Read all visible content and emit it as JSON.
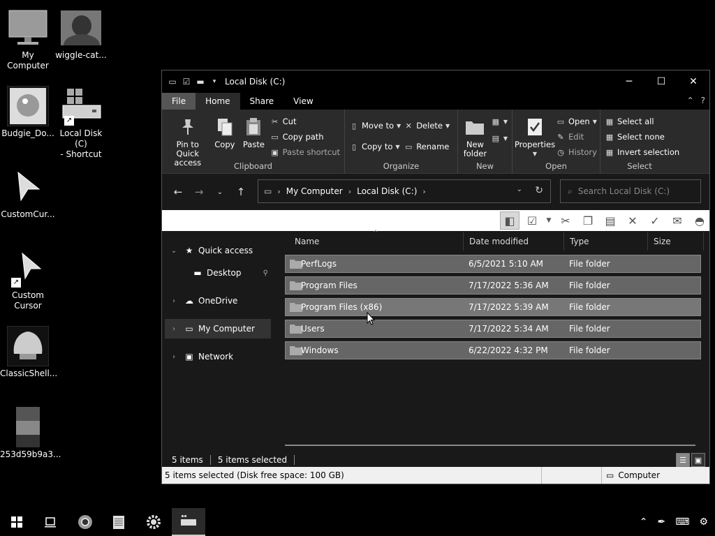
{
  "desktop": {
    "icons": [
      {
        "label": "My Computer"
      },
      {
        "label": "wiggle-cat..."
      },
      {
        "label": "Budgie_Do..."
      },
      {
        "label": "Local Disk (C)\n- Shortcut"
      },
      {
        "label": "CustomCur..."
      },
      {
        "label": "Custom\nCursor"
      },
      {
        "label": "ClassicShell..."
      },
      {
        "label": "253d59b9a3..."
      }
    ]
  },
  "window": {
    "title": "Local Disk (C:)",
    "controls": {
      "minimize": "─",
      "maximize": "☐",
      "close": "✕"
    }
  },
  "ribbon": {
    "tabs": [
      "File",
      "Home",
      "Share",
      "View"
    ],
    "clipboard": {
      "label": "Clipboard",
      "pin": "Pin to Quick access",
      "copy": "Copy",
      "paste": "Paste",
      "cut": "Cut",
      "copy_path": "Copy path",
      "paste_shortcut": "Paste shortcut"
    },
    "organize": {
      "label": "Organize",
      "move_to": "Move to",
      "copy_to": "Copy to",
      "delete": "Delete",
      "rename": "Rename"
    },
    "new": {
      "label": "New",
      "new_folder": "New folder"
    },
    "open": {
      "label": "Open",
      "properties": "Properties",
      "open": "Open",
      "edit": "Edit",
      "history": "History"
    },
    "select": {
      "label": "Select",
      "select_all": "Select all",
      "select_none": "Select none",
      "invert": "Invert selection"
    }
  },
  "address": {
    "crumbs": [
      "My Computer",
      "Local Disk (C:)"
    ],
    "search_placeholder": "Search Local Disk (C:)"
  },
  "navpane": {
    "items": [
      {
        "label": "Quick access"
      },
      {
        "label": "Desktop"
      },
      {
        "label": "OneDrive"
      },
      {
        "label": "My Computer"
      },
      {
        "label": "Network"
      }
    ]
  },
  "filelist": {
    "columns": [
      "Name",
      "Date modified",
      "Type",
      "Size"
    ],
    "rows": [
      {
        "name": "PerfLogs",
        "date": "6/5/2021 5:10 AM",
        "type": "File folder"
      },
      {
        "name": "Program Files",
        "date": "7/17/2022 5:36 AM",
        "type": "File folder"
      },
      {
        "name": "Program Files (x86)",
        "date": "7/17/2022 5:39 AM",
        "type": "File folder"
      },
      {
        "name": "Users",
        "date": "7/17/2022 5:34 AM",
        "type": "File folder"
      },
      {
        "name": "Windows",
        "date": "6/22/2022 4:32 PM",
        "type": "File folder"
      }
    ]
  },
  "status": {
    "items": "5 items",
    "selected": "5 items selected"
  },
  "classic_status": {
    "left": "5 items selected (Disk free space: 100 GB)",
    "right": "Computer"
  }
}
